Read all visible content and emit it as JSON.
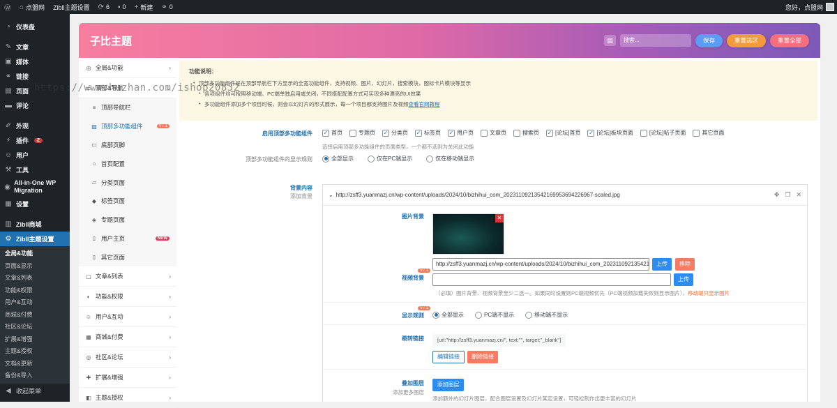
{
  "adminbar": {
    "site": "点盟网",
    "theme": "Zibll主题设置",
    "views": "6",
    "comments": "0",
    "new": "新建",
    "links": "0",
    "greeting": "您好，点盟网"
  },
  "menu": {
    "items": [
      {
        "label": "仪表盘",
        "icon": "dashboard-icon"
      },
      {
        "label": "文章",
        "icon": "pin-icon"
      },
      {
        "label": "媒体",
        "icon": "media-icon"
      },
      {
        "label": "链接",
        "icon": "link-icon"
      },
      {
        "label": "页面",
        "icon": "page-icon"
      },
      {
        "label": "评论",
        "icon": "comment-icon"
      },
      {
        "label": "外观",
        "icon": "brush-icon"
      },
      {
        "label": "插件",
        "icon": "plugin-icon",
        "badge": "2"
      },
      {
        "label": "用户",
        "icon": "user-icon"
      },
      {
        "label": "工具",
        "icon": "wrench-icon"
      },
      {
        "label": "All-in-One WP Migration",
        "icon": "migration-icon"
      },
      {
        "label": "设置",
        "icon": "settings-icon"
      },
      {
        "label": "Zibll商城",
        "icon": "store-icon"
      },
      {
        "label": "Zibll主题设置",
        "icon": "gear-icon"
      }
    ],
    "submenu": [
      "全局&功能",
      "页面&显示",
      "文章&列表",
      "功能&权限",
      "用户&互动",
      "商城&付费",
      "社区&论坛",
      "扩展&增强",
      "主题&授权",
      "文档&更新",
      "备份&导入"
    ],
    "collapse": "收起菜单"
  },
  "header": {
    "title": "子比主题",
    "search_placeholder": "搜索...",
    "save": "保存",
    "reset_section": "重置选区",
    "reset_all": "重置全部"
  },
  "nav": {
    "top": [
      {
        "label": "全局&功能"
      }
    ],
    "current_label": "顶部&导航",
    "subs": [
      {
        "label": "顶部导航栏"
      },
      {
        "label": "顶部多功能组件",
        "tag": "V7.1"
      },
      {
        "label": "底部页脚"
      },
      {
        "label": "首页配置"
      },
      {
        "label": "分类页面"
      },
      {
        "label": "标签页面"
      },
      {
        "label": "专题页面"
      },
      {
        "label": "用户主页",
        "tag": "NEW"
      },
      {
        "label": "其它页面"
      }
    ],
    "groups": [
      {
        "label": "文章&列表"
      },
      {
        "label": "功能&权限"
      },
      {
        "label": "用户&互动"
      },
      {
        "label": "商城&付费"
      },
      {
        "label": "社区&论坛"
      },
      {
        "label": "扩展&增强"
      },
      {
        "label": "主题&授权"
      }
    ]
  },
  "notice": {
    "title": "功能说明：",
    "lines": [
      "顶部多功能组件是在顶部导航栏下方显示的全宽功能组件，支持视频、图片、幻灯片，搜索模块，图标卡片模块等显示",
      "各项组件均可按照移动端、PC端单独启用或关闭，不同搭配配置方式可实现多种漂亮的UI效果",
      "多功能组件添加多个项目时候，则会以幻灯片的形式展示，每一个项目都支持图片及视频"
    ],
    "link": "查看官网教程"
  },
  "enable": {
    "label": "启用顶部多功能组件",
    "options": [
      {
        "label": "首页",
        "checked": true
      },
      {
        "label": "专题页",
        "checked": false
      },
      {
        "label": "分类页",
        "checked": true
      },
      {
        "label": "标签页",
        "checked": true
      },
      {
        "label": "用户页",
        "checked": true
      },
      {
        "label": "文章页",
        "checked": false
      },
      {
        "label": "搜索页",
        "checked": false
      },
      {
        "label": "[论坛]首页",
        "checked": true
      },
      {
        "label": "[论坛]板块页面",
        "checked": true
      },
      {
        "label": "[论坛]帖子页面",
        "checked": false
      },
      {
        "label": "其它页面",
        "checked": false
      }
    ],
    "desc": "选择启用顶部多功能组件的页面类型，一个都不选则为关闭此功能"
  },
  "rule": {
    "label": "顶部多功能组件的显示规则",
    "options": [
      "全部显示",
      "仅在PC端显示",
      "仅在移动端显示"
    ],
    "selected": 0
  },
  "bg": {
    "label": "背景内容",
    "sub": "添加背景",
    "panel_title": "http://zsff3.yuanmazj.cn/wp-content/uploads/2024/10/bizhihui_com_20231109213542169953694226967-scaled.jpg",
    "image_label": "图片背景",
    "image_url": "http://zsff3.yuanmazj.cn/wp-content/uploads/2024/10/bizhihui_com_20231109213542169953694226967-scaled.jpg",
    "upload": "上传",
    "remove": "移除",
    "video_label": "视频背景",
    "video_tag": "V7.1",
    "video_url": "",
    "video_desc": "（必填）图片背景、视频背景至少二选一。如果同时设置则PC端视频优先（PC端视频加载失败则显示图片），",
    "video_desc_warn": "移动端只显示图片",
    "show_label": "显示规则",
    "show_tag": "V7.1",
    "show_options": [
      "全部显示",
      "PC端不显示",
      "移动端不显示"
    ],
    "show_selected": 0,
    "link_label": "跳转链接",
    "link_value": "[url:\"http://zsff3.yuanmazj.cn/\", text:\"\", target:\"_blank\"]",
    "edit_link": "编辑链接",
    "delete_link": "删除链接",
    "layer_label": "叠加图层",
    "layer_sub": "添加更多图层",
    "add_layer": "添加图层",
    "layer_desc": "添加额外的幻灯片图层，配合图层设置及幻灯片某定设置，可轻松制作出更丰富的幻灯片"
  },
  "watermark": "https://www.huzhan.com/ishop20832",
  "colors": {
    "accent": "#2271b1",
    "save": "#5b9cf5",
    "reset_section": "#f39a3d",
    "reset_all": "#f56e7b",
    "upload": "#2d8cf0",
    "remove": "#f77b63"
  }
}
